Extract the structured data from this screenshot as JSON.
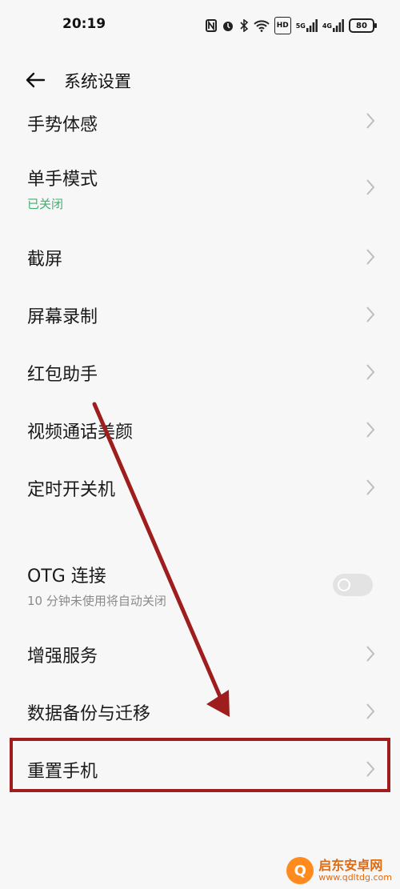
{
  "status_bar": {
    "time": "20:19",
    "icons": [
      "nfc-icon",
      "alarm-icon",
      "bluetooth-icon",
      "wifi-icon",
      "hd-icon",
      "signal-5g-icon",
      "signal-4g-icon",
      "battery-icon"
    ],
    "hd_label": "HD",
    "net1_label": "5G",
    "net2_label": "4G",
    "battery_level": "80"
  },
  "header": {
    "back_icon": "back-arrow-icon",
    "title": "系统设置"
  },
  "items": [
    {
      "label": "手势体感"
    },
    {
      "label": "单手模式",
      "sub": "已关闭"
    },
    {
      "label": "截屏"
    },
    {
      "label": "屏幕录制"
    },
    {
      "label": "红包助手"
    },
    {
      "label": "视频通话美颜"
    },
    {
      "label": "定时开关机"
    },
    {
      "label": "OTG 连接",
      "sub": "10 分钟未使用将自动关闭",
      "toggle_on": false
    },
    {
      "label": "增强服务"
    },
    {
      "label": "数据备份与迁移"
    },
    {
      "label": "重置手机"
    }
  ],
  "colors": {
    "accent_sub": "#3fb06f",
    "annotation": "#9e1d1d",
    "chevron": "#bdbdbd"
  },
  "watermark": {
    "title": "启东安卓网",
    "url": "www.qdltdg.com",
    "logo_char": "Q"
  }
}
